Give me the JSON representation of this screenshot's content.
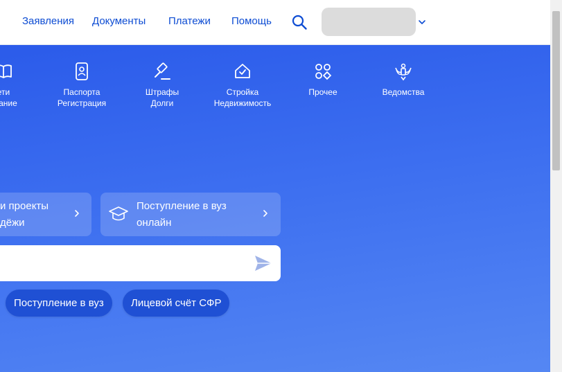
{
  "header": {
    "nav": [
      {
        "label": "Заявления"
      },
      {
        "label": "Документы"
      },
      {
        "label": "Платежи"
      },
      {
        "label": "Помощь"
      }
    ]
  },
  "categories": [
    {
      "line1": "ети",
      "line2": "ование",
      "icon": "book-icon"
    },
    {
      "line1": "Паспорта",
      "line2": "Регистрация",
      "icon": "passport-icon"
    },
    {
      "line1": "Штрафы",
      "line2": "Долги",
      "icon": "gavel-icon"
    },
    {
      "line1": "Стройка",
      "line2": "Недвижимость",
      "icon": "house-icon"
    },
    {
      "line1": "Прочее",
      "line2": "",
      "icon": "grid-icon"
    },
    {
      "line1": "Ведомства",
      "line2": "",
      "icon": "coat-of-arms-icon"
    }
  ],
  "cards": [
    {
      "line1": "и проекты",
      "line2": "дёжи"
    },
    {
      "line1": "Поступление в вуз",
      "line2": "онлайн",
      "icon": "graduation-cap-icon"
    }
  ],
  "search": {
    "placeholder": ""
  },
  "chips": [
    {
      "label": "Поступление в вуз"
    },
    {
      "label": "Лицевой счёт СФР"
    }
  ],
  "colors": {
    "primary": "#0d4cd3",
    "hero": "#3d6ff0",
    "chip": "#1f50d4"
  }
}
